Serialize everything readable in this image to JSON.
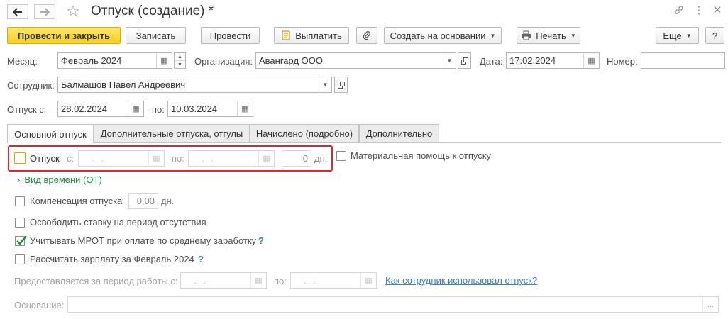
{
  "window": {
    "title": "Отпуск (создание) *"
  },
  "toolbar": {
    "post_close": "Провести и закрыть",
    "save": "Записать",
    "post": "Провести",
    "pay": "Выплатить",
    "create_based_on": "Создать на основании",
    "print": "Печать",
    "more": "Еще",
    "help": "?"
  },
  "form": {
    "month_label": "Месяц:",
    "month_value": "Февраль 2024",
    "org_label": "Организация:",
    "org_value": "Авангард ООО",
    "date_label": "Дата:",
    "date_value": "17.02.2024",
    "number_label": "Номер:",
    "number_value": "",
    "employee_label": "Сотрудник:",
    "employee_value": "Балмашов Павел Андреевич",
    "leave_from_label": "Отпуск с:",
    "leave_from_value": "28.02.2024",
    "leave_to_label": "по:",
    "leave_to_value": "10.03.2024"
  },
  "tabs": [
    {
      "label": "Основной отпуск",
      "active": true
    },
    {
      "label": "Дополнительные отпуска, отгулы",
      "active": false
    },
    {
      "label": "Начислено (подробно)",
      "active": false
    },
    {
      "label": "Дополнительно",
      "active": false
    }
  ],
  "main_tab": {
    "vacation_checkbox_label": "Отпуск",
    "vacation_checked": false,
    "from_label": "с:",
    "from_placeholder": ". .",
    "to_label": "по:",
    "to_placeholder": ". .",
    "days_value": "0",
    "days_unit": "дн.",
    "material_help_label": "Материальная помощь к отпуску",
    "material_help_checked": false,
    "time_type_link": "Вид времени (ОТ)",
    "compensation_label": "Компенсация отпуска",
    "compensation_checked": false,
    "compensation_value": "0,00",
    "compensation_unit": "дн.",
    "release_rate_label": "Освободить ставку на период отсутствия",
    "release_rate_checked": false,
    "mrot_label": "Учитывать МРОТ при оплате по среднему заработку",
    "mrot_checked": true,
    "mrot_help": "?",
    "calc_salary_label": "Рассчитать зарплату за Февраль 2024",
    "calc_salary_checked": false,
    "calc_salary_help": "?",
    "work_period_label": "Предоставляется за период работы с:",
    "work_period_from_placeholder": ". .",
    "work_period_to_label": "по:",
    "work_period_to_placeholder": ". .",
    "used_vacation_link": "Как сотрудник использовал отпуск?",
    "basis_label": "Основание:",
    "basis_value": "",
    "basis_button": "..."
  },
  "colors": {
    "primary_button": "#f6cf20",
    "highlight_border": "#e0242b",
    "link": "#3b7dc5",
    "green_link": "#1a8a3c",
    "check": "#1a8a3c"
  }
}
